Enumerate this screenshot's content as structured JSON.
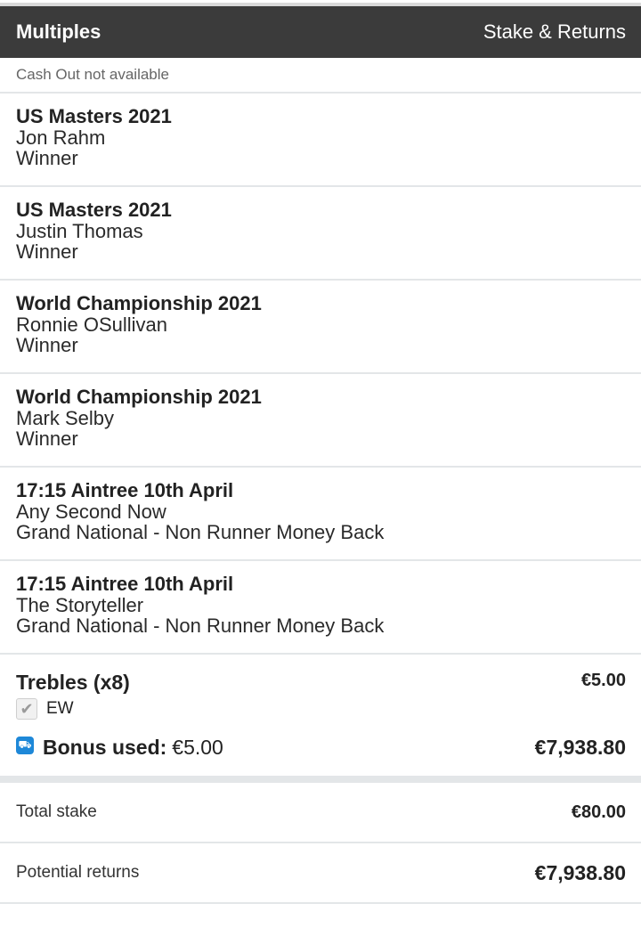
{
  "header": {
    "title": "Multiples",
    "right_label": "Stake & Returns"
  },
  "cashout_note": "Cash Out not available",
  "selections": [
    {
      "event": "US Masters 2021",
      "pick": "Jon Rahm",
      "market": "Winner"
    },
    {
      "event": "US Masters 2021",
      "pick": "Justin Thomas",
      "market": "Winner"
    },
    {
      "event": "World Championship 2021",
      "pick": "Ronnie OSullivan",
      "market": "Winner"
    },
    {
      "event": "World Championship 2021",
      "pick": "Mark Selby",
      "market": "Winner"
    },
    {
      "event": "17:15 Aintree 10th April",
      "pick": "Any Second Now",
      "market": "Grand National - Non Runner Money Back"
    },
    {
      "event": "17:15 Aintree 10th April",
      "pick": "The Storyteller",
      "market": "Grand National - Non Runner Money Back"
    }
  ],
  "bet": {
    "type": "Trebles (x8)",
    "stake": "€5.00",
    "ew_label": "EW",
    "ew_checked": true,
    "bonus_label": "Bonus used:",
    "bonus_value": "€5.00",
    "returns": "€7,938.80"
  },
  "summary": {
    "total_stake_label": "Total stake",
    "total_stake_value": "€80.00",
    "potential_returns_label": "Potential returns",
    "potential_returns_value": "€7,938.80"
  },
  "icons": {
    "checkbox": "check-icon",
    "bonus": "bonus-icon"
  },
  "colors": {
    "header_bg": "#3b3b3b",
    "bonus_icon": "#1e88d8",
    "divider": "#e3e6e8"
  }
}
